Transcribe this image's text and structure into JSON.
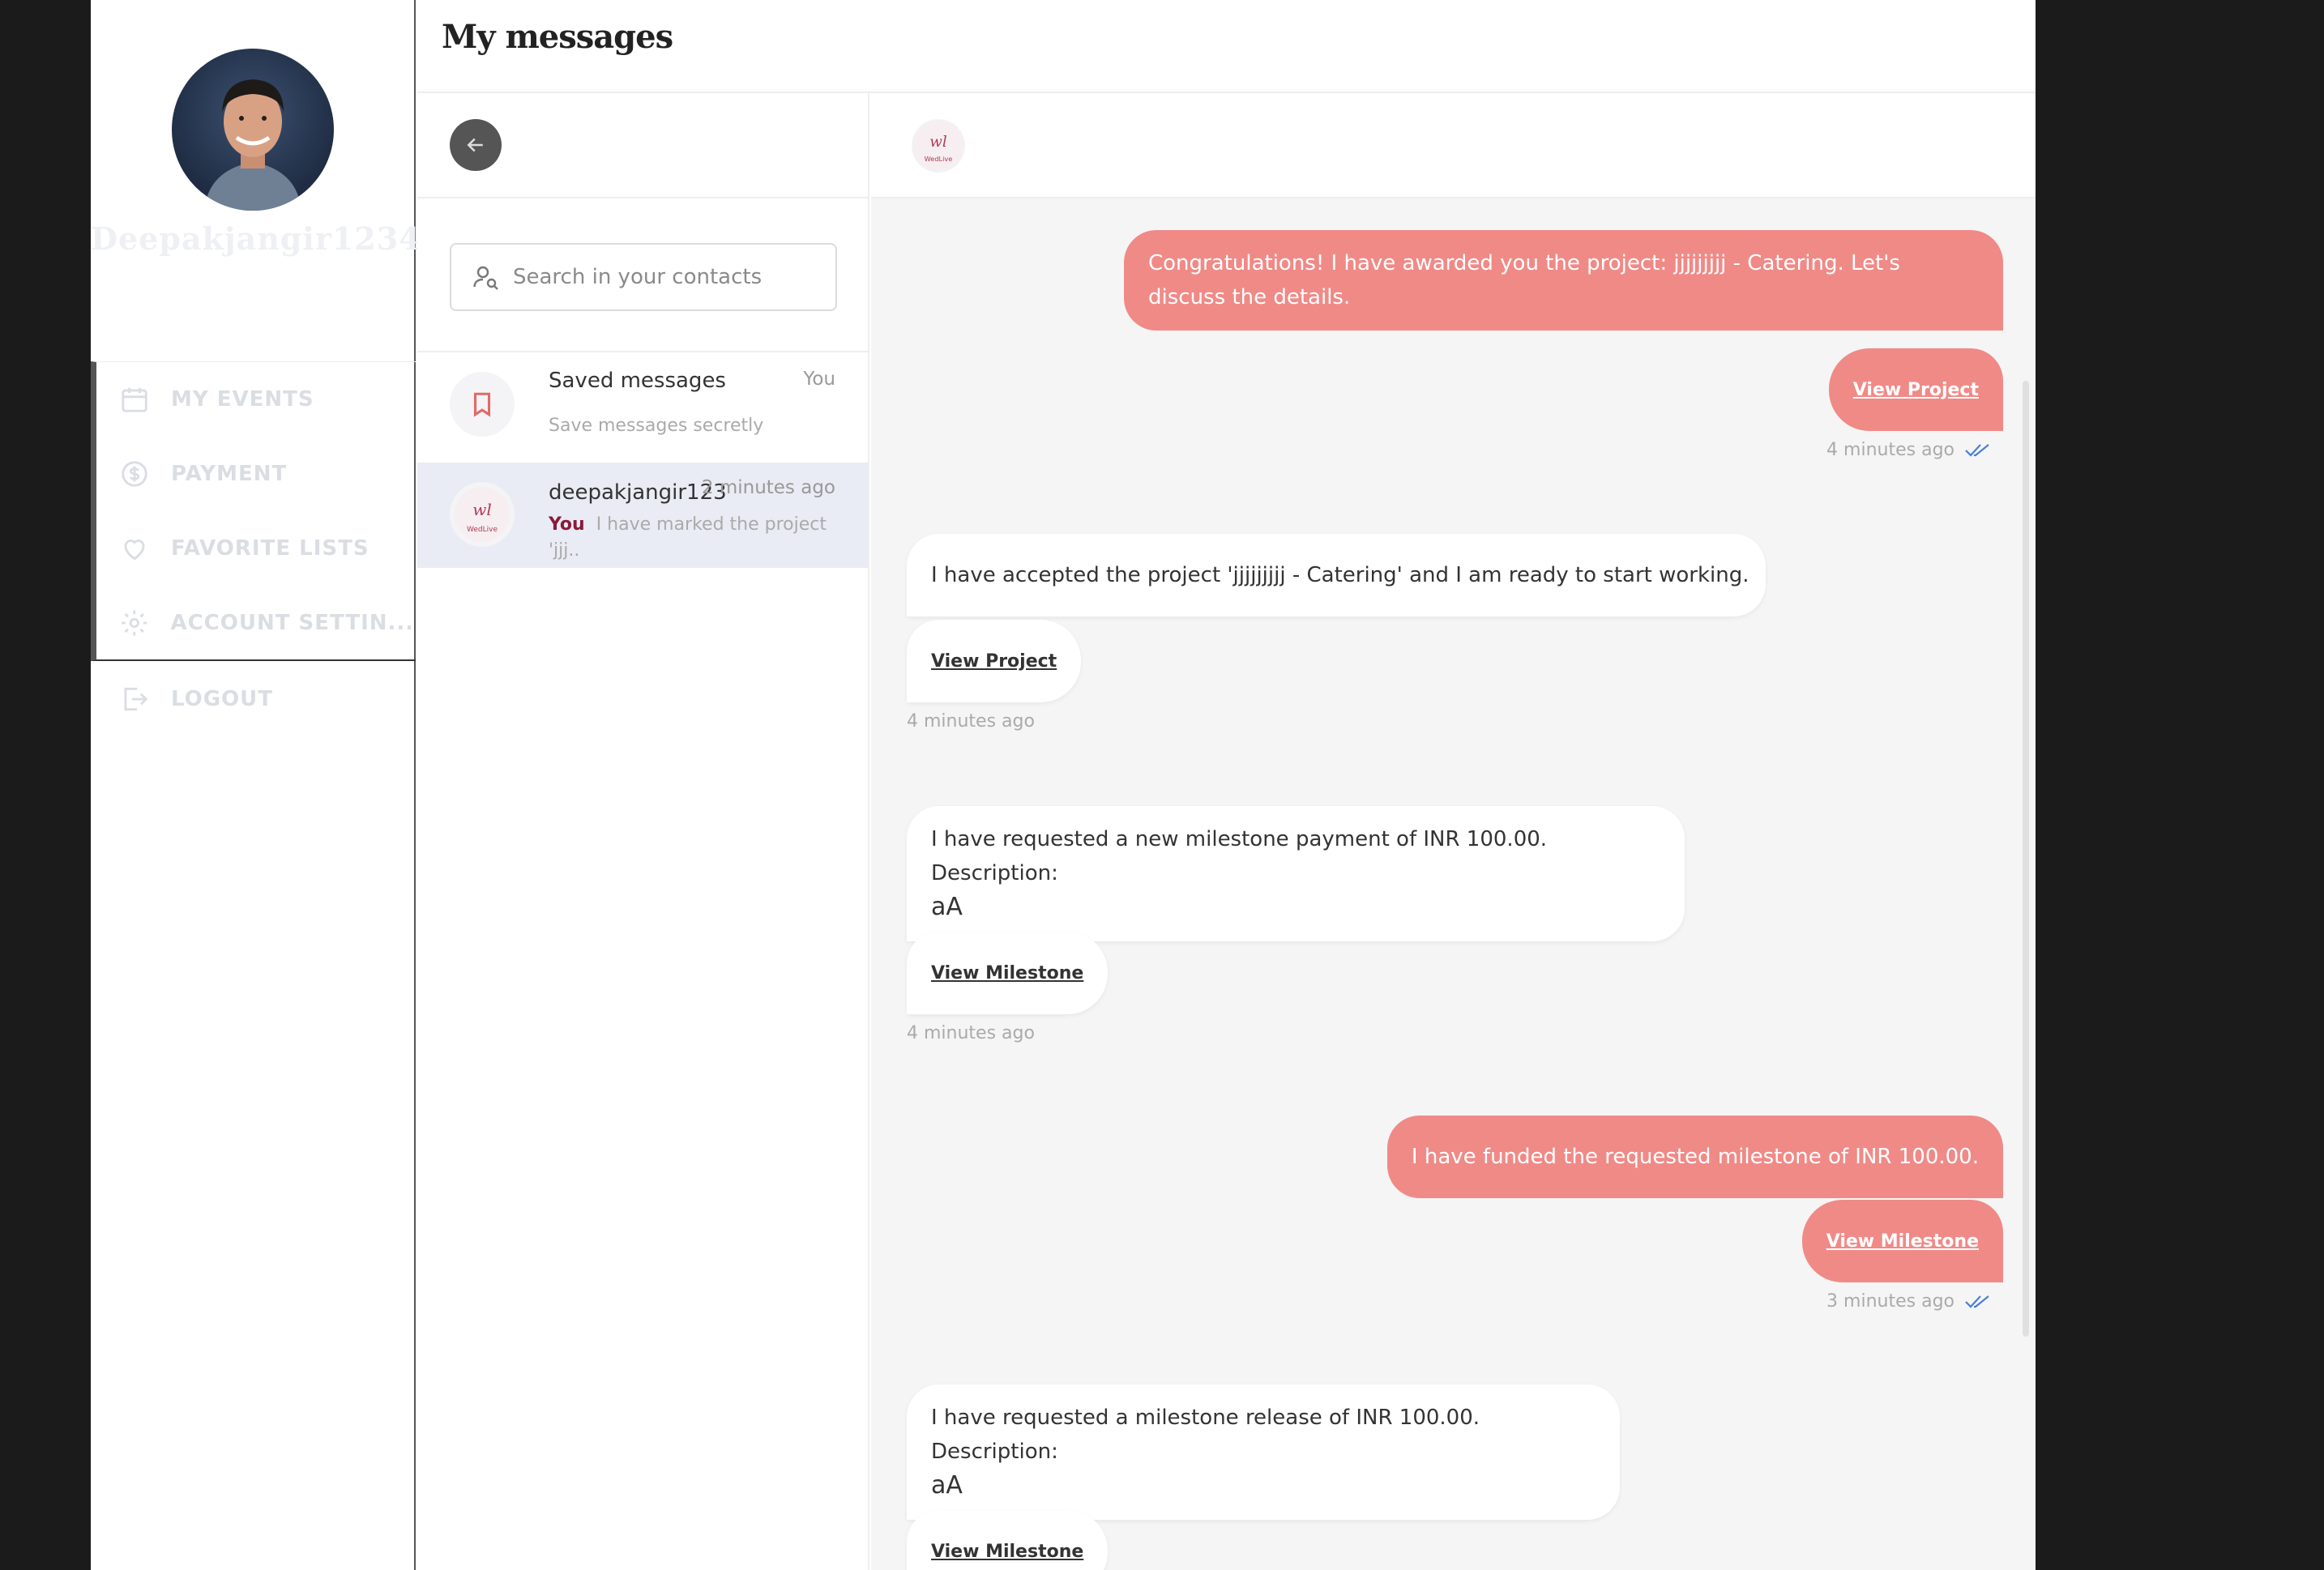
{
  "sidebar": {
    "username": "Deepakjangir1234",
    "nav": [
      {
        "label": "MY EVENTS",
        "icon": "calendar-icon"
      },
      {
        "label": "PAYMENT",
        "icon": "dollar-circle-icon"
      },
      {
        "label": "FAVORITE LISTS",
        "icon": "heart-icon"
      },
      {
        "label": "ACCOUNT SETTIN...",
        "icon": "gear-icon"
      }
    ],
    "logout": "LOGOUT"
  },
  "header": {
    "title": "My messages"
  },
  "contacts": {
    "search_placeholder": "Search in your contacts",
    "items": [
      {
        "name": "Saved messages",
        "meta": "You",
        "sub": "Save messages secretly"
      },
      {
        "name": "deepakjangir123",
        "meta": "2 minutes ago",
        "you": "You",
        "sub": "I have marked the project",
        "sub2": "'jjj.."
      }
    ]
  },
  "chat": {
    "messages": [
      {
        "text_1": "Congratulations! I have awarded you the project: jjjjjjjjj - Catering. Let's",
        "text_2": "discuss the details.",
        "link": "View Project",
        "time": "4 minutes ago"
      },
      {
        "text": "I have accepted the project 'jjjjjjjjj - Catering' and I am ready to start working.",
        "link": "View Project",
        "time": "4 minutes ago"
      },
      {
        "text_1": "I have requested a new milestone payment of INR 100.00. Description:",
        "text_2": "aA",
        "link": "View Milestone",
        "time": "4 minutes ago"
      },
      {
        "text": "I have funded the requested milestone of INR 100.00.",
        "link": "View Milestone",
        "time": "3 minutes ago"
      },
      {
        "text_1": "I have requested a milestone release of INR 100.00. Description:",
        "text_2": "aA",
        "link": "View Milestone"
      }
    ]
  },
  "colors": {
    "accent": "#f08a87",
    "read_ticks": "#4a7fd4",
    "you_label": "#8b1a3a"
  }
}
